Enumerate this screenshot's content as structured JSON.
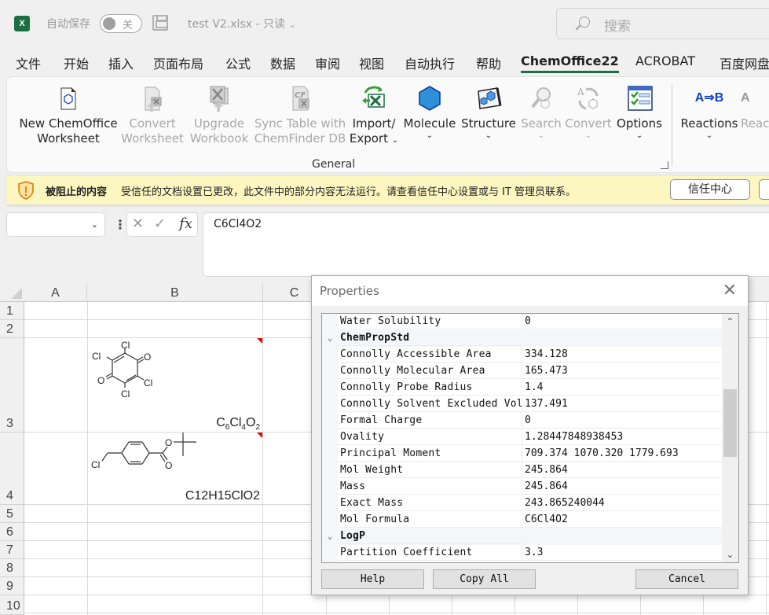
{
  "titlebar": {
    "app_icon": "excel-icon",
    "autosave_label": "自动保存",
    "autosave_state": "关",
    "save_icon": "save-icon",
    "file_title": "test V2.xlsx",
    "separator": "-",
    "mode": "只读",
    "search_placeholder": "搜索"
  },
  "menu_tabs": [
    {
      "label": "文件"
    },
    {
      "label": "开始"
    },
    {
      "label": "插入"
    },
    {
      "label": "页面布局"
    },
    {
      "label": "公式"
    },
    {
      "label": "数据"
    },
    {
      "label": "审阅"
    },
    {
      "label": "视图"
    },
    {
      "label": "自动执行"
    },
    {
      "label": "帮助"
    },
    {
      "label": "ChemOffice22",
      "active": true
    },
    {
      "label": "ACROBAT"
    },
    {
      "label": "百度网盘"
    }
  ],
  "ribbon": {
    "group_label": "General",
    "buttons": [
      {
        "line1": "New ChemOffice",
        "line2": "Worksheet",
        "icon": "new-worksheet-icon",
        "enabled": true
      },
      {
        "line1": "Convert",
        "line2": "Worksheet",
        "icon": "convert-worksheet-icon",
        "enabled": false
      },
      {
        "line1": "Upgrade",
        "line2": "Workbook",
        "icon": "upgrade-workbook-icon",
        "enabled": false
      },
      {
        "line1": "Sync Table with",
        "line2": "ChemFinder DB",
        "icon": "sync-table-icon",
        "enabled": false
      },
      {
        "line1": "Import/",
        "line2": "Export",
        "icon": "import-export-icon",
        "enabled": true,
        "dropdown": true
      },
      {
        "line1": "Molecule",
        "line2": "",
        "icon": "molecule-icon",
        "enabled": true,
        "dropdown": true
      },
      {
        "line1": "Structure",
        "line2": "",
        "icon": "structure-icon",
        "enabled": true,
        "dropdown": true
      },
      {
        "line1": "Search",
        "line2": "",
        "icon": "search-icon",
        "enabled": false,
        "dropdown": true
      },
      {
        "line1": "Convert",
        "line2": "",
        "icon": "convert-icon",
        "enabled": false,
        "dropdown": true
      },
      {
        "line1": "Options",
        "line2": "",
        "icon": "options-icon",
        "enabled": true,
        "dropdown": true
      },
      {
        "line1": "Reactions",
        "line2": "",
        "icon": "reactions-icon",
        "enabled": true,
        "dropdown": true
      },
      {
        "line1": "Reac",
        "line2": "",
        "icon": "reactions2-icon",
        "enabled": false,
        "dropdown": true
      }
    ],
    "reactions_glyph": "A⇒B",
    "dropdown_glyph": "⌄"
  },
  "warning": {
    "title": "被阻止的内容",
    "text": "受信任的文档设置已更改，此文件中的部分内容无法运行。请查看信任中心设置或与 IT 管理员联系。",
    "button": "信任中心"
  },
  "formula_bar": {
    "name_box": "",
    "cancel_glyph": "✕",
    "enter_glyph": "✓",
    "fx_label": "fx",
    "value": "C6Cl4O2"
  },
  "sheet": {
    "columns": [
      "A",
      "B",
      "C"
    ],
    "rows": [
      "1",
      "2",
      "3",
      "4",
      "5",
      "6",
      "7",
      "8",
      "9",
      "10"
    ],
    "cells": {
      "B3": {
        "formula_base": [
          "C",
          "Cl",
          "O"
        ],
        "formula_subs": [
          "6",
          "4",
          "2"
        ],
        "structure": "tetrachloro-p-benzoquinone"
      },
      "B4": {
        "text": "C12H15ClO2",
        "structure": "tert-butyl 4-(chloromethyl)benzoate"
      }
    },
    "atom_labels": {
      "cl": "Cl",
      "o": "O"
    }
  },
  "dialog": {
    "title": "Properties",
    "close_glyph": "✕",
    "rows": [
      {
        "type": "prop",
        "name": "Water Solubility",
        "value": "0"
      },
      {
        "type": "cat",
        "name": "ChemPropStd"
      },
      {
        "type": "prop",
        "name": "Connolly Accessible Area",
        "value": "334.128"
      },
      {
        "type": "prop",
        "name": "Connolly Molecular Area",
        "value": "165.473"
      },
      {
        "type": "prop",
        "name": "Connolly Probe Radius",
        "value": "1.4"
      },
      {
        "type": "prop",
        "name": "Connolly Solvent Excluded Volume",
        "value": "137.491"
      },
      {
        "type": "prop",
        "name": "Formal Charge",
        "value": "0"
      },
      {
        "type": "prop",
        "name": "Ovality",
        "value": "1.28447848938453"
      },
      {
        "type": "prop",
        "name": "Principal Moment",
        "value": "709.374 1070.320 1779.693"
      },
      {
        "type": "prop",
        "name": "Mol Weight",
        "value": "245.864"
      },
      {
        "type": "prop",
        "name": "Mass",
        "value": "245.864"
      },
      {
        "type": "prop",
        "name": "Exact Mass",
        "value": "243.865240044"
      },
      {
        "type": "prop",
        "name": "Mol Formula",
        "value": "C6Cl4O2"
      },
      {
        "type": "cat",
        "name": "LogP"
      },
      {
        "type": "prop",
        "name": "Partition Coefficient",
        "value": "3.3"
      }
    ],
    "expand_glyph": "⌄",
    "scroll_up": "⌃",
    "scroll_down": "⌄",
    "buttons": {
      "help": "Help",
      "copy_all": "Copy All",
      "cancel": "Cancel"
    }
  },
  "colors": {
    "excel_green": "#1d6f42",
    "warning_bg": "#fcf6c1",
    "comment_red": "#e00000",
    "reactions_blue": "#1040c0"
  }
}
